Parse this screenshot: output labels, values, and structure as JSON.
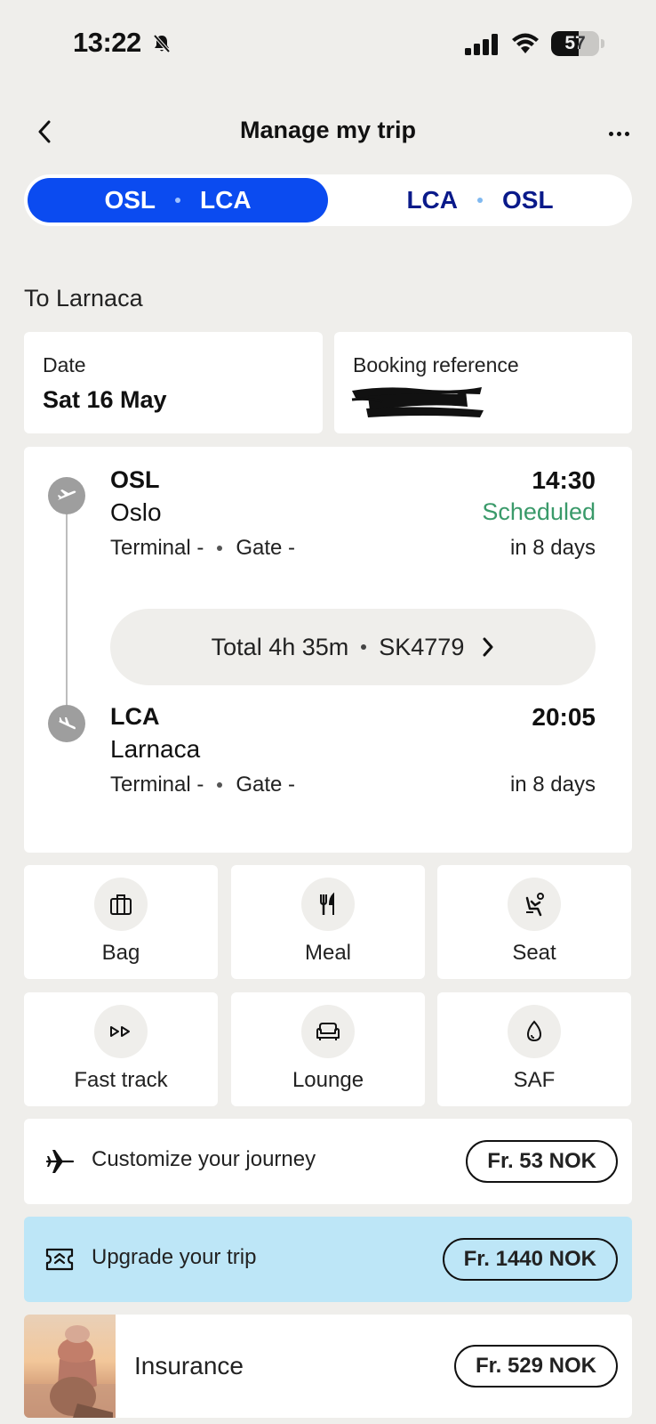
{
  "status_bar": {
    "time": "13:22",
    "battery": "57",
    "battery_level": 0.57
  },
  "header": {
    "title": "Manage my trip"
  },
  "segments": [
    {
      "from": "OSL",
      "to": "LCA"
    },
    {
      "from": "LCA",
      "to": "OSL"
    }
  ],
  "destination": "To Larnaca",
  "date_card": {
    "label": "Date",
    "value": "Sat 16 May"
  },
  "booking_card": {
    "label": "Booking reference"
  },
  "flight": {
    "departure": {
      "code": "OSL",
      "city": "Oslo",
      "time": "14:30",
      "status": "Scheduled",
      "terminal": "Terminal -",
      "gate": "Gate -",
      "relative": "in 8 days"
    },
    "total": "Total 4h 35m",
    "flight_number": "SK4779",
    "arrival": {
      "code": "LCA",
      "city": "Larnaca",
      "time": "20:05",
      "terminal": "Terminal -",
      "gate": "Gate -",
      "relative": "in 8 days"
    }
  },
  "services": [
    {
      "label": "Bag",
      "icon": "bag-icon"
    },
    {
      "label": "Meal",
      "icon": "meal-icon"
    },
    {
      "label": "Seat",
      "icon": "seat-icon"
    },
    {
      "label": "Fast track",
      "icon": "fast-track-icon"
    },
    {
      "label": "Lounge",
      "icon": "lounge-icon"
    },
    {
      "label": "SAF",
      "icon": "saf-icon"
    }
  ],
  "offers": {
    "customize": {
      "label": "Customize your journey",
      "price": "Fr. 53 NOK",
      "icon": "airplane-icon"
    },
    "upgrade": {
      "label": "Upgrade your trip",
      "price": "Fr. 1440 NOK",
      "icon": "upgrade-ticket-icon"
    },
    "insurance": {
      "label": "Insurance",
      "price": "Fr. 529 NOK"
    }
  },
  "colors": {
    "primary": "#0b4bf0",
    "scheduled": "#3a9a6a",
    "upgrade_bg": "#bde6f7",
    "background": "#efeeeb"
  }
}
